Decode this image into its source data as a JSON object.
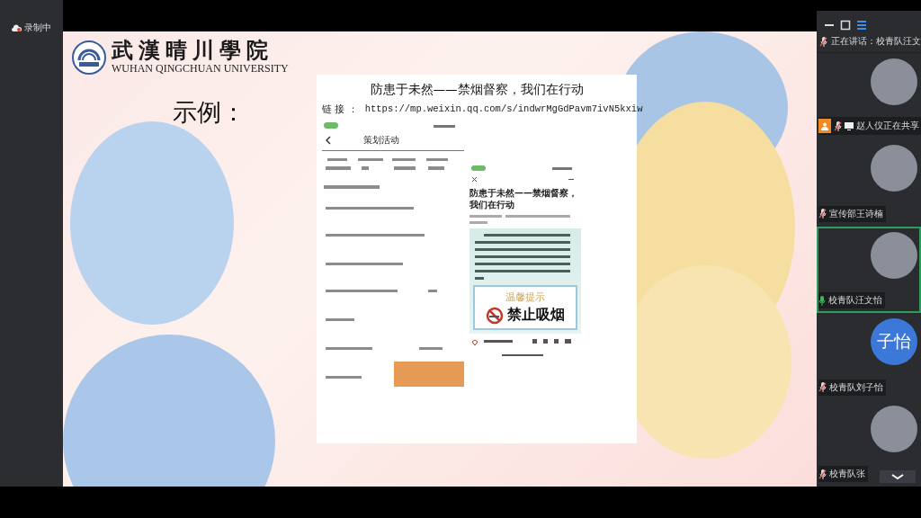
{
  "recording": {
    "label": "录制中"
  },
  "slide": {
    "logo": {
      "name_cn": "武漢晴川學院",
      "name_en": "WUHAN QINGCHUAN UNIVERSITY"
    },
    "heading": "示例：",
    "document": {
      "title": "防患于未然——禁烟督察，我们在行动",
      "link_label": "链 接 ：",
      "link_url": "https://mp.weixin.qq.com/s/indwrMgGdPavm7ivN5kxiw"
    },
    "phone_left": {
      "title": "策划活动"
    },
    "phone_right": {
      "title": "防患于未然——禁烟督察，我们在行动",
      "poster_heading": "温馨提示",
      "poster_sign": "禁止吸烟"
    }
  },
  "panel": {
    "speaking": "正在讲话：校青队汪文",
    "participants": [
      {
        "name": "赵人仪正在共享",
        "kind": "photo",
        "sharing": true,
        "muted": true,
        "active": false
      },
      {
        "name": "宣传部王诗楠",
        "kind": "photo",
        "sharing": false,
        "muted": true,
        "active": false
      },
      {
        "name": "校青队汪文怡",
        "kind": "photo",
        "sharing": false,
        "muted": false,
        "active": true
      },
      {
        "name": "校青队刘子怡",
        "kind": "text",
        "avatar_text": "子怡",
        "sharing": false,
        "muted": true,
        "active": false
      },
      {
        "name": "校青队张",
        "kind": "photo",
        "sharing": false,
        "muted": true,
        "active": false
      }
    ]
  }
}
